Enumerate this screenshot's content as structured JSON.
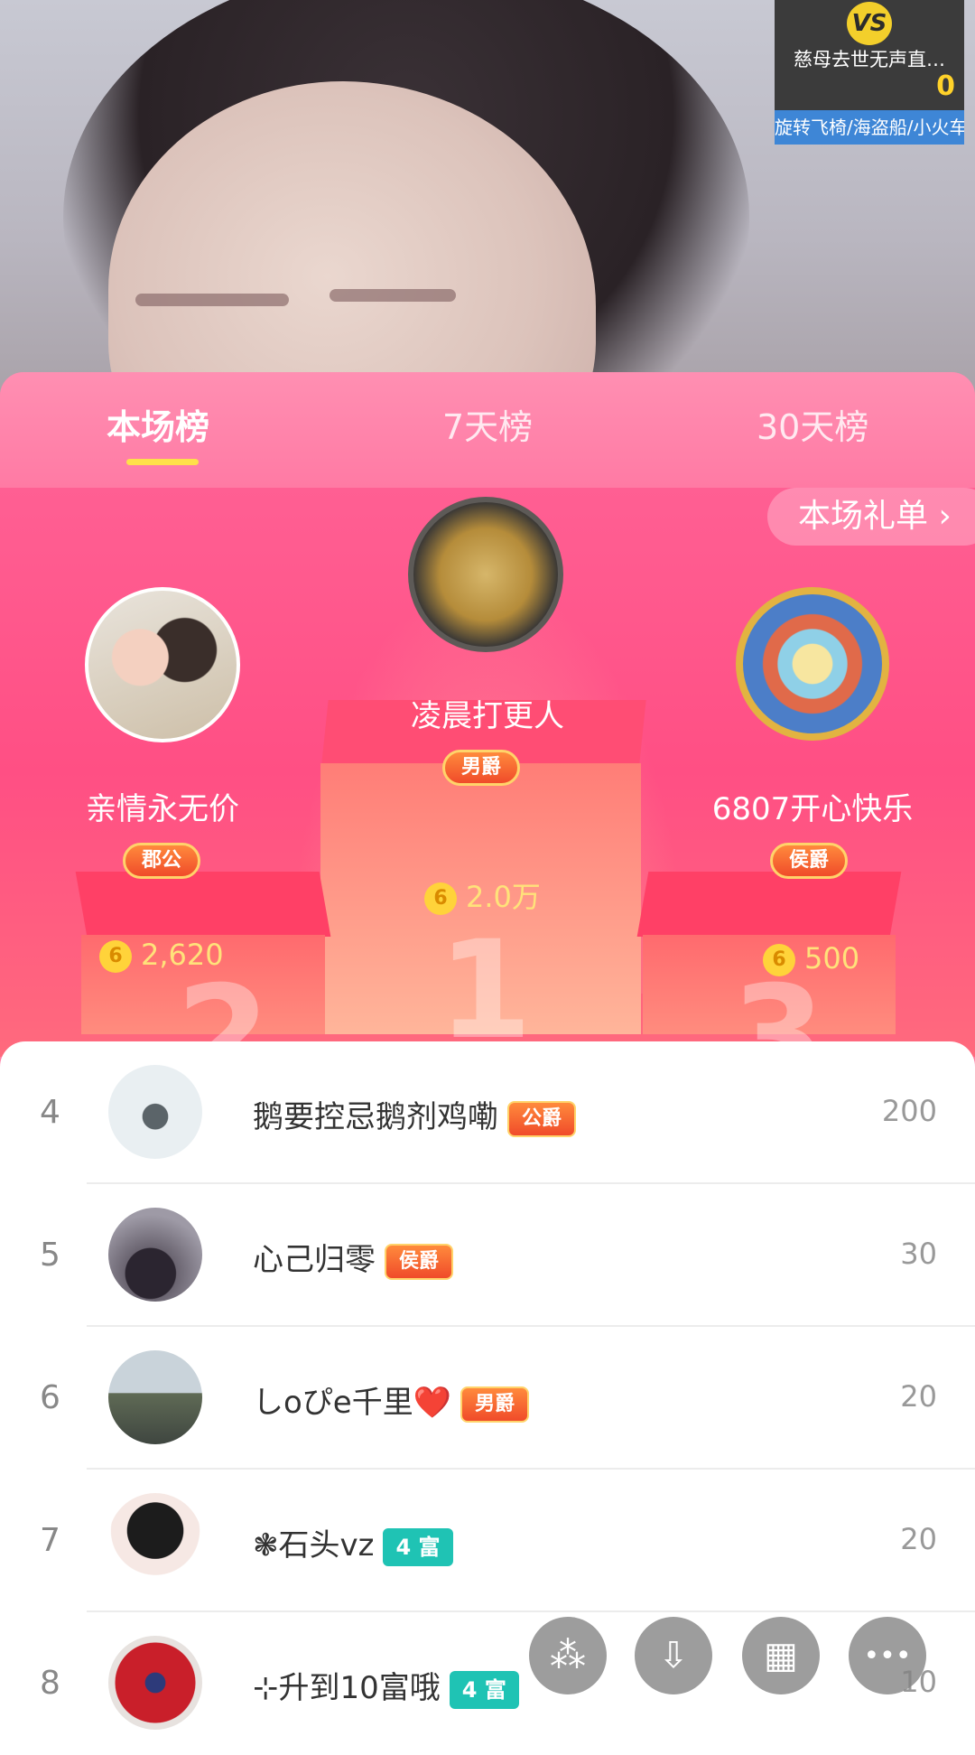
{
  "vs_widget": {
    "badge": "VS",
    "title": "慈母去世无声直…",
    "score": "0",
    "footer": "旋转飞椅/海盗船/小火车"
  },
  "tabs": [
    {
      "label": "本场榜",
      "active": true
    },
    {
      "label": "7天榜",
      "active": false
    },
    {
      "label": "30天榜",
      "active": false
    }
  ],
  "gift_list_button": "本场礼单 ›",
  "podium": {
    "first": {
      "name": "凌晨打更人",
      "title": "男爵",
      "score": "2.0万"
    },
    "second": {
      "name": "亲情永无价",
      "title": "郡公",
      "score": "2,620"
    },
    "third": {
      "name": "6807开心快乐",
      "title": "侯爵",
      "score": "500"
    },
    "coin_symbol": "6",
    "digits": [
      "1",
      "2",
      "3"
    ]
  },
  "list": [
    {
      "rank": "4",
      "name": "鹅要控忌鹅剂鸡嘞",
      "badge": "公爵",
      "badge_type": "noble",
      "value": "200"
    },
    {
      "rank": "5",
      "name": "心己归零",
      "badge": "侯爵",
      "badge_type": "noble",
      "value": "30"
    },
    {
      "rank": "6",
      "name": "しoぴe千里❤️",
      "badge": "男爵",
      "badge_type": "noble",
      "value": "20"
    },
    {
      "rank": "7",
      "name": "❃石头vz",
      "badge": "4 富",
      "badge_type": "rich",
      "value": "20"
    },
    {
      "rank": "8",
      "name": "⊹升到10富哦",
      "badge": "4 富",
      "badge_type": "rich",
      "value": "10"
    }
  ],
  "fabs": [
    {
      "icon": "sparkle-icon",
      "glyph": "⁂"
    },
    {
      "icon": "download-icon",
      "glyph": "⇩"
    },
    {
      "icon": "grid-icon",
      "glyph": "▦"
    },
    {
      "icon": "more-icon",
      "glyph": "•••"
    }
  ],
  "colors": {
    "tab_bg": "#ff8fb2",
    "podium_bg": "#ff5f93",
    "tab_underline": "#ffe04a",
    "score": "#ffe27a",
    "rich_badge": "#1fc3b4",
    "noble_badge": "#f04b2a"
  }
}
